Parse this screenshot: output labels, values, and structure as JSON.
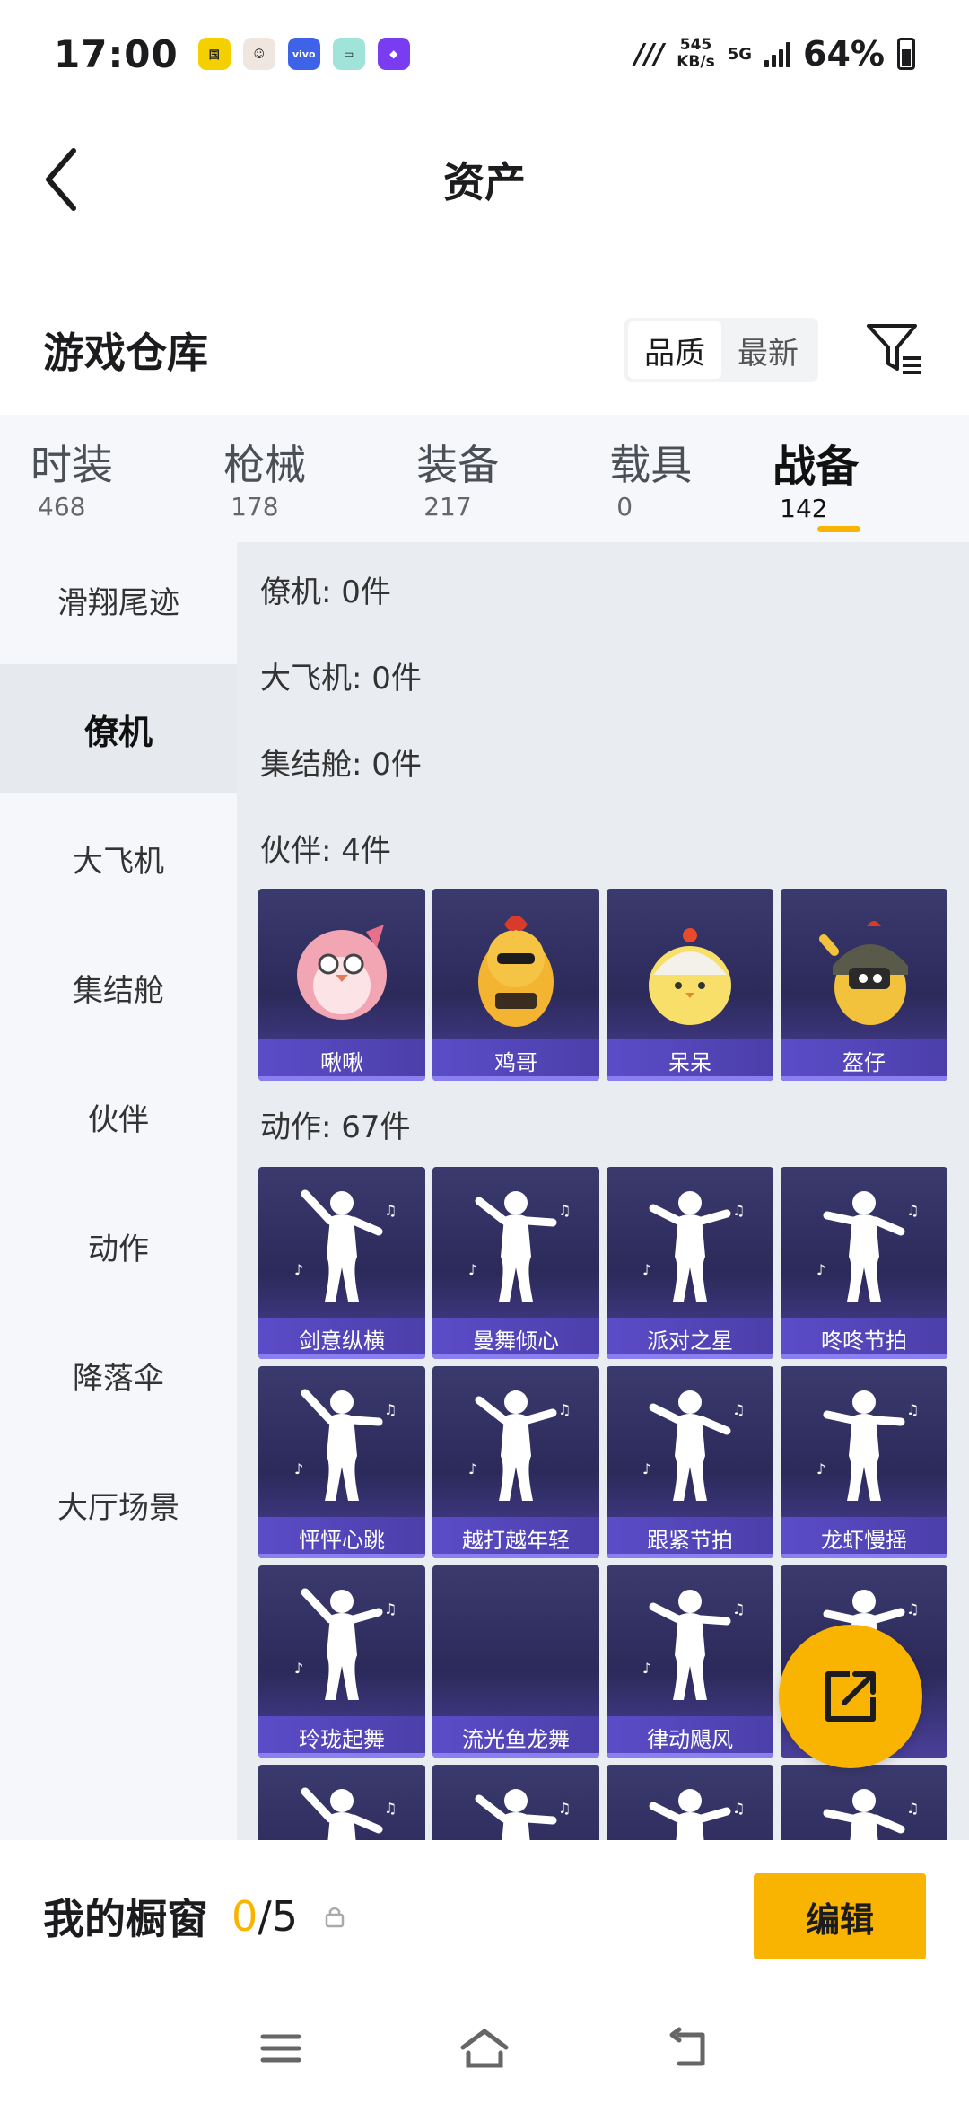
{
  "status_bar": {
    "time": "17:00",
    "speed_value": "545",
    "speed_unit": "KB/s",
    "network": "5G",
    "battery": "64%",
    "app_icons": [
      "store-icon",
      "avatar-icon",
      "vivo-icon",
      "note-icon",
      "purple-app-icon"
    ]
  },
  "header": {
    "title": "资产"
  },
  "warehouse": {
    "title": "游戏仓库",
    "sort_options": [
      "品质",
      "最新"
    ],
    "active_sort": "品质"
  },
  "tabs": [
    {
      "label": "时装",
      "count": "468"
    },
    {
      "label": "枪械",
      "count": "178"
    },
    {
      "label": "装备",
      "count": "217"
    },
    {
      "label": "载具",
      "count": "0"
    },
    {
      "label": "战备",
      "count": "142"
    }
  ],
  "active_tab": "战备",
  "sidebar": {
    "items": [
      "滑翔尾迹",
      "僚机",
      "大飞机",
      "集结舱",
      "伙伴",
      "动作",
      "降落伞",
      "大厅场景"
    ],
    "active": "僚机"
  },
  "sections": {
    "wingman": "僚机: 0件",
    "big_plane": "大飞机: 0件",
    "assembly": "集结舱: 0件",
    "partner": "伙伴: 4件",
    "emote": "动作: 67件"
  },
  "partner_items": [
    "啾啾",
    "鸡哥",
    "呆呆",
    "盔仔"
  ],
  "emote_items": [
    "剑意纵横",
    "曼舞倾心",
    "派对之星",
    "咚咚节拍",
    "怦怦心跳",
    "越打越年轻",
    "跟紧节拍",
    "龙虾慢摇",
    "玲珑起舞",
    "流光鱼龙舞",
    "律动飓风",
    "",
    "",
    "",
    "",
    ""
  ],
  "showcase": {
    "title": "我的橱窗",
    "current": "0",
    "separator": "/",
    "total": "5",
    "edit_label": "编辑"
  },
  "colors": {
    "accent": "#f8b400",
    "card_bg": "#2c2a5a",
    "card_label_bg": "#5b4cc8"
  }
}
